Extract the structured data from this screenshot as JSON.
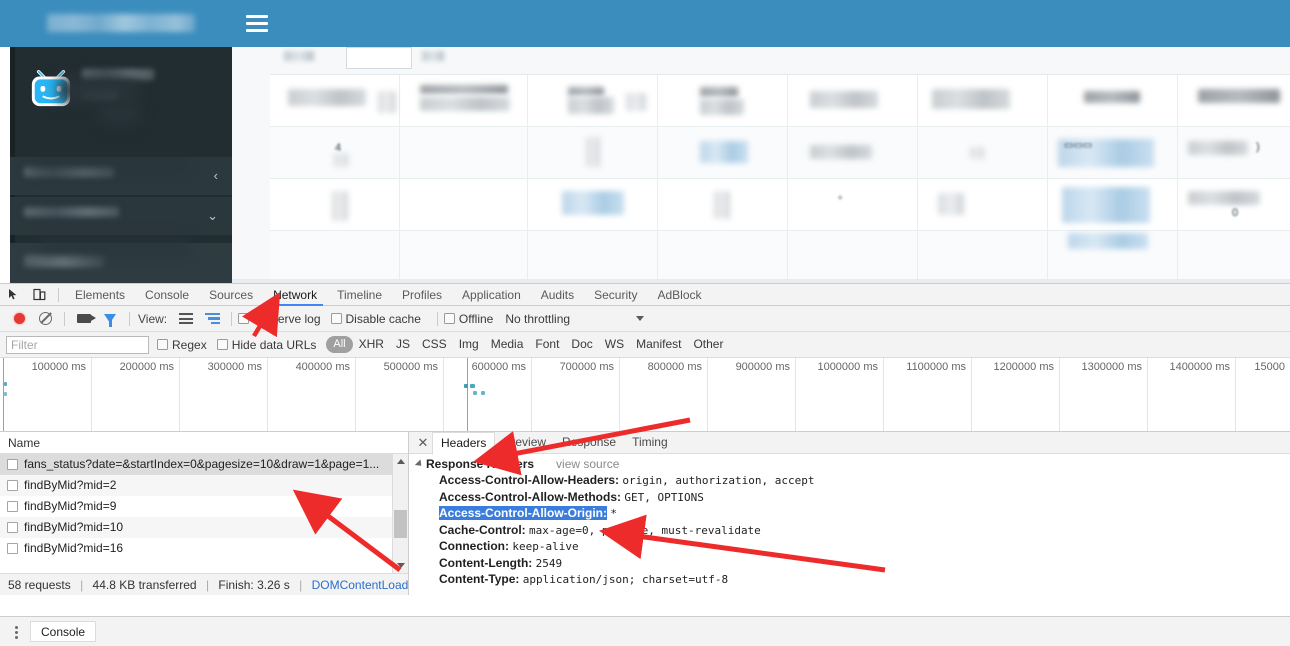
{
  "webpage": {
    "topbar": {
      "brand_redacted": true
    },
    "menu_icon": "hamburger-icon",
    "sidebar": {
      "logo": "tv-mascot-logo",
      "collapse_icon": "chevron-left-icon",
      "expand_icon": "chevron-down-icon"
    }
  },
  "devtools": {
    "panel_tabs": [
      {
        "label": "Elements",
        "active": false
      },
      {
        "label": "Console",
        "active": false
      },
      {
        "label": "Sources",
        "active": false
      },
      {
        "label": "Network",
        "active": true
      },
      {
        "label": "Timeline",
        "active": false
      },
      {
        "label": "Profiles",
        "active": false
      },
      {
        "label": "Application",
        "active": false
      },
      {
        "label": "Audits",
        "active": false
      },
      {
        "label": "Security",
        "active": false
      },
      {
        "label": "AdBlock",
        "active": false
      }
    ],
    "toolbar": {
      "record_icon": "record-icon",
      "clear_icon": "clear-icon",
      "camera_icon": "camera-icon",
      "filter_icon": "funnel-icon",
      "view_label": "View:",
      "list_view_icon": "list-view-icon",
      "waterfall_view_icon": "waterfall-view-icon",
      "preserve_log": "Preserve log",
      "disable_cache": "Disable cache",
      "offline": "Offline",
      "throttling": "No throttling",
      "throttling_caret": "chevron-down-icon"
    },
    "filterbar": {
      "filter_placeholder": "Filter",
      "filter_value": "",
      "regex_label": "Regex",
      "hide_data_urls_label": "Hide data URLs",
      "types": [
        {
          "label": "All",
          "active": true
        },
        {
          "label": "XHR",
          "active": false
        },
        {
          "label": "JS",
          "active": false
        },
        {
          "label": "CSS",
          "active": false
        },
        {
          "label": "Img",
          "active": false
        },
        {
          "label": "Media",
          "active": false
        },
        {
          "label": "Font",
          "active": false
        },
        {
          "label": "Doc",
          "active": false
        },
        {
          "label": "WS",
          "active": false
        },
        {
          "label": "Manifest",
          "active": false
        },
        {
          "label": "Other",
          "active": false
        }
      ]
    },
    "timeline": {
      "ticks": [
        "100000 ms",
        "200000 ms",
        "300000 ms",
        "400000 ms",
        "500000 ms",
        "600000 ms",
        "700000 ms",
        "800000 ms",
        "900000 ms",
        "1000000 ms",
        "1100000 ms",
        "1200000 ms",
        "1300000 ms",
        "1400000 ms",
        "15000"
      ],
      "event_line_color": "#f07c7c",
      "request_mark_color": "#4aa8c0"
    },
    "requests": {
      "column_header": "Name",
      "rows": [
        {
          "name": "fans_status?date=&startIndex=0&pagesize=10&draw=1&page=1...",
          "selected": true
        },
        {
          "name": "findByMid?mid=2",
          "selected": false
        },
        {
          "name": "findByMid?mid=9",
          "selected": false
        },
        {
          "name": "findByMid?mid=10",
          "selected": false
        },
        {
          "name": "findByMid?mid=16",
          "selected": false
        }
      ],
      "status": {
        "requests": "58 requests",
        "transferred": "44.8 KB transferred",
        "finish": "Finish: 3.26 s",
        "dom_content_loaded": "DOMContentLoaded: ..."
      }
    },
    "detail": {
      "close_icon": "close-icon",
      "tabs": [
        {
          "label": "Headers",
          "active": true
        },
        {
          "label": "Preview",
          "active": false
        },
        {
          "label": "Response",
          "active": false
        },
        {
          "label": "Timing",
          "active": false
        }
      ],
      "section_title": "Response Headers",
      "view_source": "view source",
      "headers": [
        {
          "key": "Access-Control-Allow-Headers:",
          "value": "origin, authorization, accept",
          "highlighted": false
        },
        {
          "key": "Access-Control-Allow-Methods:",
          "value": "GET, OPTIONS",
          "highlighted": false
        },
        {
          "key": "Access-Control-Allow-Origin:",
          "value": "*",
          "highlighted": true
        },
        {
          "key": "Cache-Control:",
          "value": "max-age=0, private, must-revalidate",
          "highlighted": false
        },
        {
          "key": "Connection:",
          "value": "keep-alive",
          "highlighted": false
        },
        {
          "key": "Content-Length:",
          "value": "2549",
          "highlighted": false
        },
        {
          "key": "Content-Type:",
          "value": "application/json; charset=utf-8",
          "highlighted": false
        }
      ]
    },
    "drawer": {
      "menu_icon": "kebab-menu-icon",
      "tab_label": "Console"
    }
  },
  "colors": {
    "brand_blue": "#3b8dbd",
    "accent_tab": "#4285f4",
    "record_red": "#e53935",
    "highlight_blue": "#3b7ddd",
    "annotation_red": "#ee2b2b",
    "link_blue": "#2b6ecc",
    "sidebar_dark": "#222d32"
  }
}
